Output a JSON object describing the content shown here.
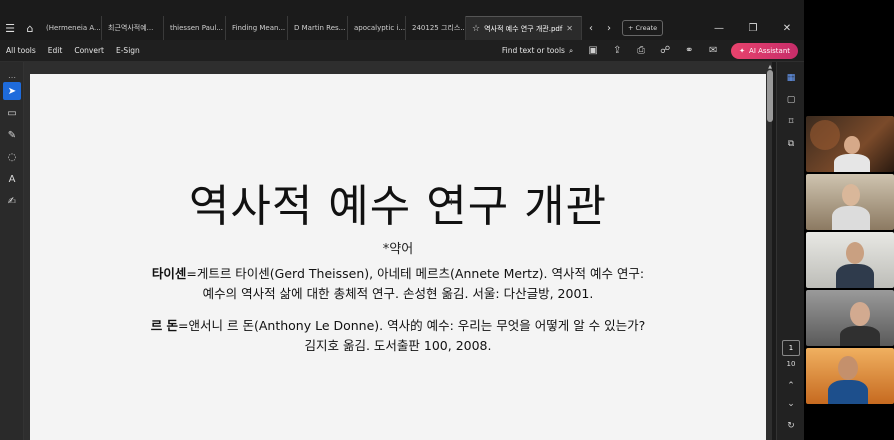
{
  "tabs": [
    {
      "label": "(Hermeneia A..."
    },
    {
      "label": "최근역사적예..."
    },
    {
      "label": "thiessen Paul..."
    },
    {
      "label": "Finding Mean..."
    },
    {
      "label": "D Martin Res..."
    },
    {
      "label": "apocalyptic i..."
    },
    {
      "label": "240125 그리스..."
    },
    {
      "label": "역사적 예수 연구 개관.pdf"
    }
  ],
  "tabbar": {
    "create_label": "Create"
  },
  "toolbar": {
    "menu": [
      "All tools",
      "Edit",
      "Convert",
      "E-Sign"
    ],
    "find_label": "Find text or tools",
    "ai_label": "AI Assistant"
  },
  "document": {
    "title": "역사적 예수 연구 개관",
    "subtitle": "*약어",
    "refs": [
      {
        "abbr": "타이센",
        "line1": "=게트르 타이센(Gerd Theissen), 아네테 메르츠(Annete Mertz). 역사적 예수 연구:",
        "line2": "예수의 역사적 삶에 대한 총체적 연구. 손성현 옮김. 서울: 다산글방, 2001."
      },
      {
        "abbr": "르 돈",
        "line1": "=앤서니 르 돈(Anthony Le Donne). 역사的 예수: 우리는 무엇을 어떻게 알 수 있는가?",
        "line2": "김지호 옮김. 도서출판 100, 2008."
      }
    ]
  },
  "pagination": {
    "current": "1",
    "total": "10"
  },
  "colors": {
    "accent": "#1e6bdc",
    "ai_button": "#d93a6b",
    "page_bg": "#f4f4f4",
    "app_bg": "#1b1b1b"
  }
}
